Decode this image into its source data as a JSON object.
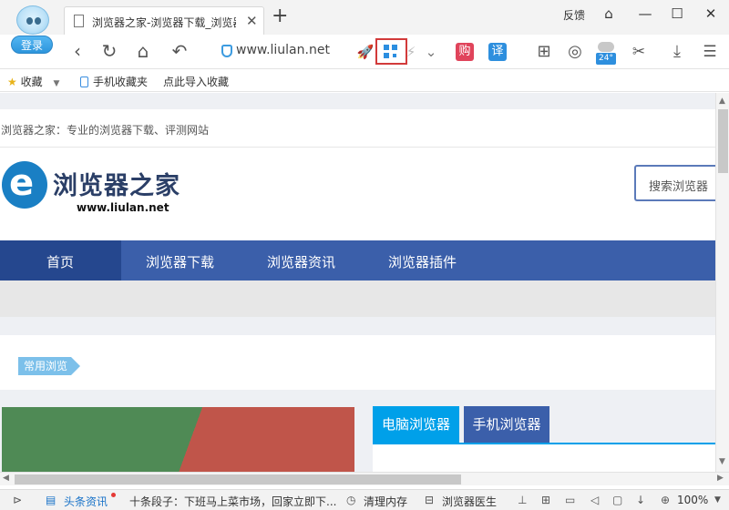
{
  "window": {
    "login_label": "登录",
    "feedback_label": "反馈",
    "controls": {
      "skin": "⌂",
      "minimize": "—",
      "maximize": "☐",
      "close": "✕"
    }
  },
  "tab": {
    "title": "浏览器之家-浏览器下载_浏览器",
    "close": "✕",
    "new_tab": "+"
  },
  "toolbar": {
    "back": "‹",
    "refresh": "↻",
    "home": "⌂",
    "undo": "↶",
    "url": "www.liulan.net",
    "rocket": "🚀",
    "lightning": "⚡",
    "chevron": "⌄",
    "buy_label": "购",
    "translate_label": "译",
    "apps": "⊞",
    "rewind": "◎",
    "temperature": "24°",
    "cut": "✂",
    "download": "⤓",
    "menu": "☰"
  },
  "bookmarks": {
    "favorites": "收藏",
    "mobile": "手机收藏夹",
    "import": "点此导入收藏"
  },
  "page": {
    "tagline": "浏览器之家：专业的浏览器下载、评测网站",
    "logo_letter": "e",
    "logo_text": "浏览器之家",
    "logo_url": "www.liulan.net",
    "search_placeholder": "搜索浏览器",
    "nav": [
      "首页",
      "浏览器下载",
      "浏览器资讯",
      "浏览器插件"
    ],
    "section_tag": "常用浏览",
    "category_tabs": [
      "电脑浏览器",
      "手机浏览器"
    ],
    "colors": {
      "nav": "#3b5faa",
      "nav_active": "#25478e",
      "tab_active": "#00a0e9",
      "tab_inactive": "#3b5faa"
    }
  },
  "status": {
    "news_label": "头条资讯",
    "ticker": "十条段子：下班马上菜市场，回家立即下...",
    "clean_memory": "清理内存",
    "doctor": "浏览器医生",
    "zoom": "100%"
  }
}
